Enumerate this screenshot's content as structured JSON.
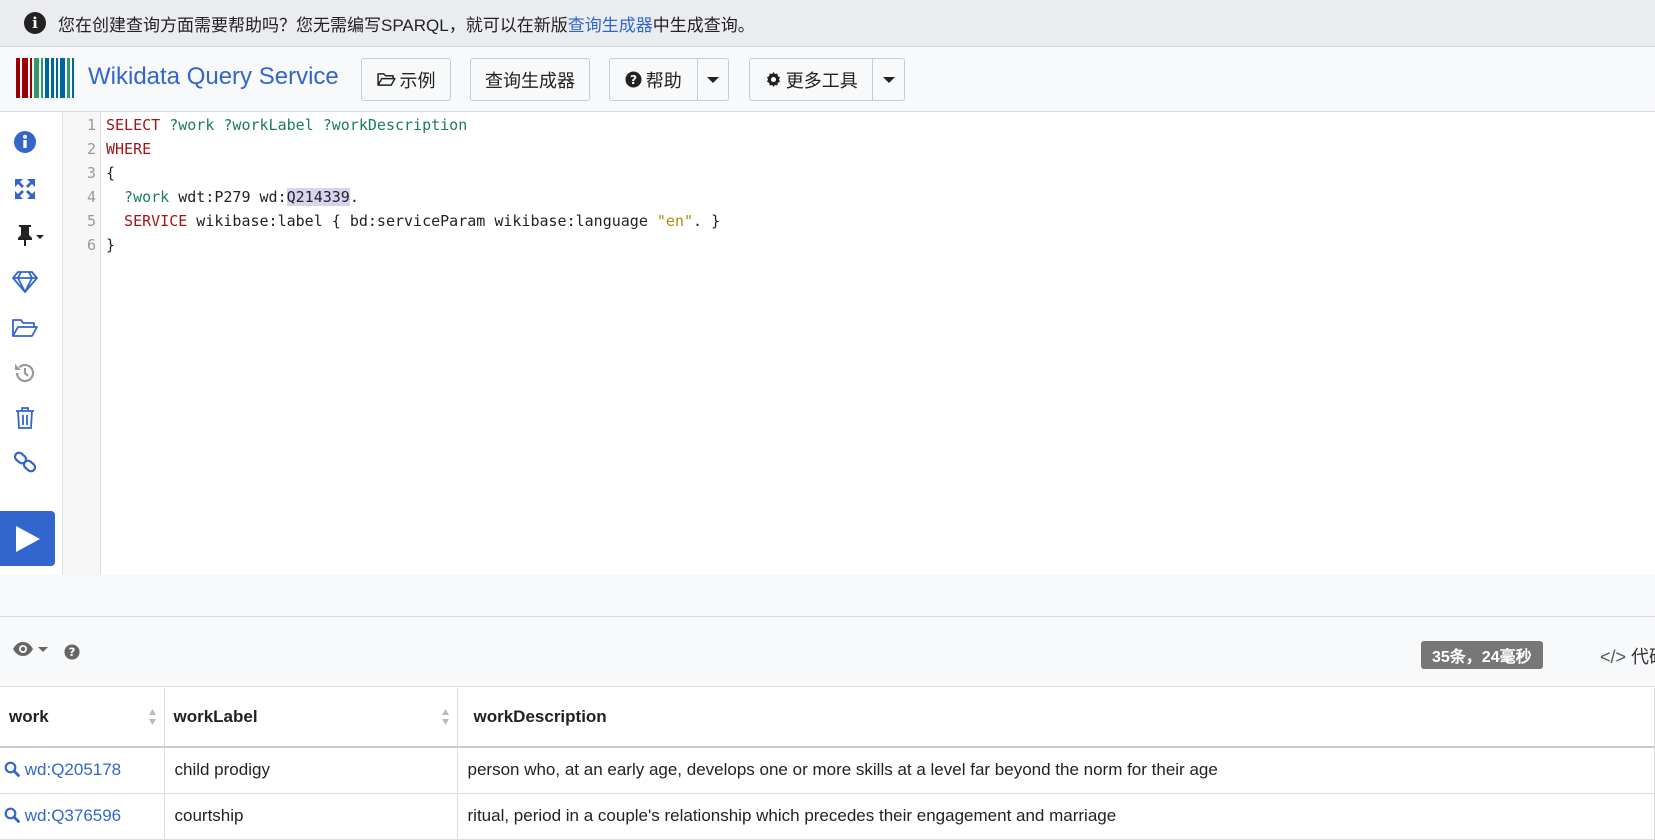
{
  "notice": {
    "text_before": "您在创建查询方面需要帮助吗？您无需编写SPARQL，就可以在新版",
    "link": "查询生成器",
    "text_after": "中生成查询。"
  },
  "navbar": {
    "brand": "Wikidata Query Service",
    "examples_label": "示例",
    "query_builder_label": "查询生成器",
    "help_label": "帮助",
    "more_tools_label": "更多工具"
  },
  "editor": {
    "lines": [
      "1",
      "2",
      "3",
      "4",
      "5",
      "6"
    ],
    "code": {
      "l1_kw": "SELECT",
      "l1_vars": " ?work ?workLabel ?workDescription",
      "l2_kw": "WHERE",
      "l3": "{",
      "l4_var": "  ?work",
      "l4_mid": " wdt:P279 wd:",
      "l4_sel": "Q214339",
      "l4_end": ".",
      "l5_kw": "  SERVICE",
      "l5_mid": " wikibase:label { bd:serviceParam wikibase:language ",
      "l5_str": "\"en\"",
      "l5_end": ". }",
      "l6": "}"
    }
  },
  "results": {
    "count_badge": "35条，24毫秒",
    "code_label": "代码",
    "columns": [
      "work",
      "workLabel",
      "workDescription"
    ],
    "rows": [
      {
        "work": "wd:Q205178",
        "label": "child prodigy",
        "description": "person who, at an early age, develops one or more skills at a level far beyond the norm for their age"
      },
      {
        "work": "wd:Q376596",
        "label": "courtship",
        "description": "ritual, period in a couple's relationship which precedes their engagement and marriage"
      }
    ]
  },
  "colors": {
    "accent": "#3366cc",
    "keyword": "#a31515",
    "variable": "#1a7d5c",
    "string": "#b8860b"
  }
}
